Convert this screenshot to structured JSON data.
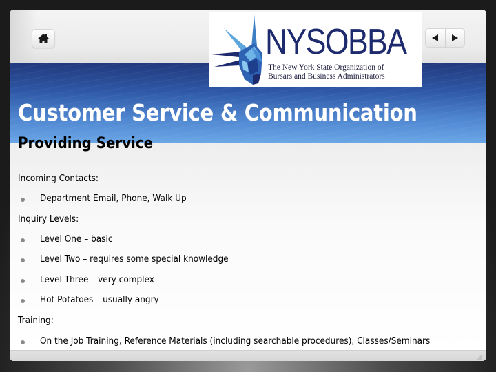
{
  "header": {
    "home_button": {
      "icon": "home-icon"
    },
    "nav": {
      "prev": {
        "icon": "triangle-left-icon"
      },
      "next": {
        "icon": "triangle-right-icon"
      }
    },
    "logo": {
      "name": "NYSOBBA",
      "subtitle_line1": "The New York State Organization of",
      "subtitle_line2": "Bursars and Business Administrators",
      "emblem": "statue-of-liberty-crown-icon"
    }
  },
  "slide": {
    "title": "Customer Service & Communication",
    "subtitle": "Providing Service",
    "sections": [
      {
        "heading": "Incoming Contacts:",
        "bullets": [
          "Department Email, Phone, Walk Up"
        ]
      },
      {
        "heading": "Inquiry Levels:",
        "bullets": [
          "Level One – basic",
          "Level Two – requires some special knowledge",
          "Level Three – very complex",
          "Hot Potatoes – usually angry"
        ]
      },
      {
        "heading": "Training:",
        "bullets": [
          "On the Job Training, Reference Materials (including searchable procedures), Classes/Seminars"
        ]
      }
    ]
  },
  "colors": {
    "title_bar_top": "#223a7e",
    "title_bar_bottom": "#6aa6e6",
    "logo_navy": "#1e2a6e",
    "bullet_gray": "#8a8a8a"
  }
}
